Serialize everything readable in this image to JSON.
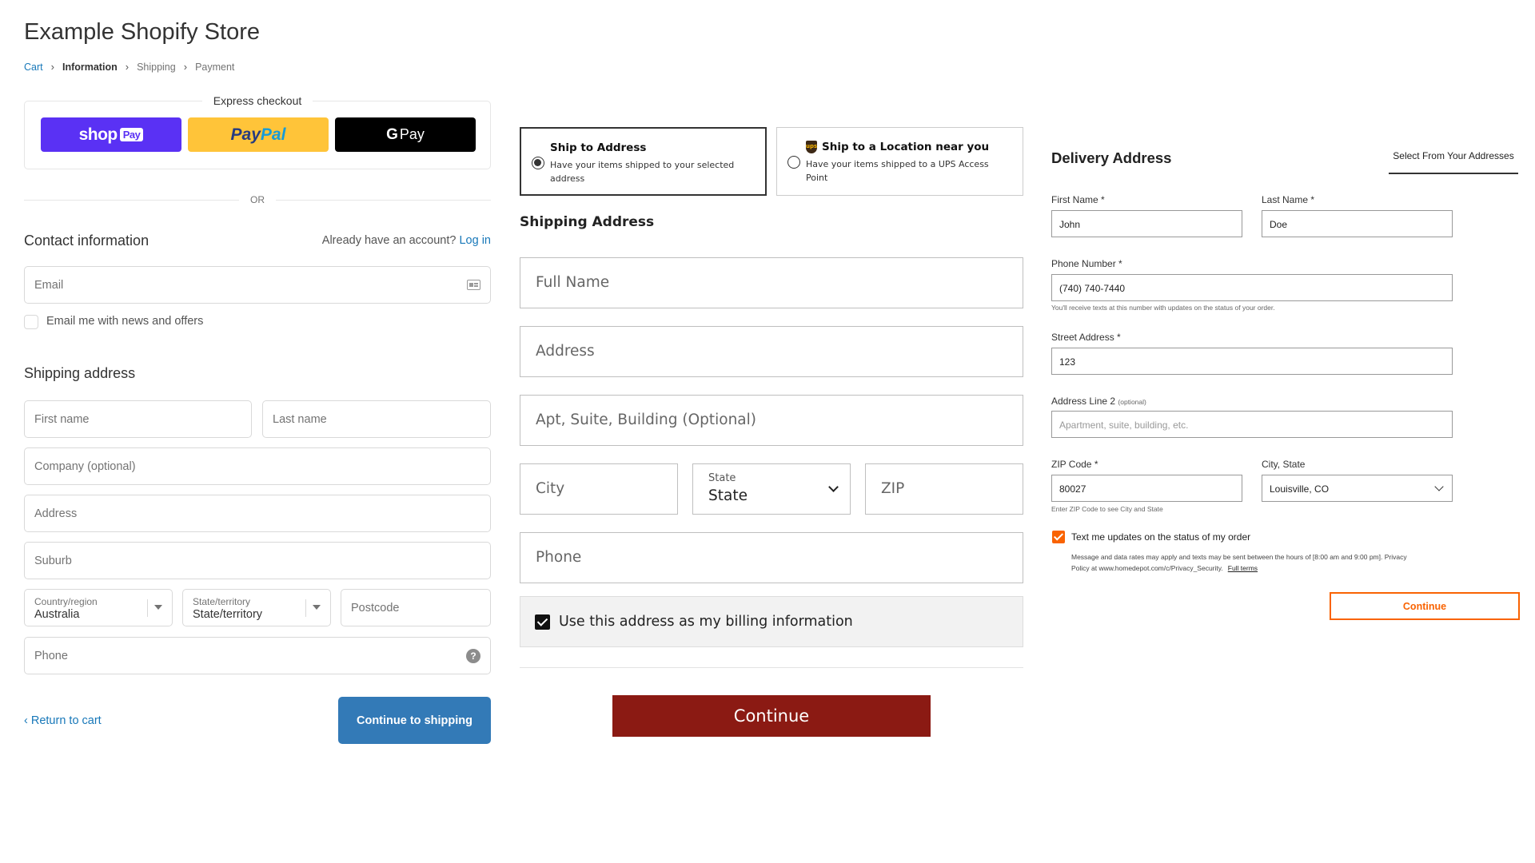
{
  "shopify": {
    "store_title": "Example Shopify Store",
    "breadcrumb": [
      "Cart",
      "Information",
      "Shipping",
      "Payment"
    ],
    "express": {
      "label": "Express checkout",
      "shop_pay": "shop",
      "shop_pay_badge": "Pay",
      "paypal_1": "Pay",
      "paypal_2": "Pal",
      "gpay_g": "G",
      "gpay_text": "Pay"
    },
    "or_label": "OR",
    "contact": {
      "heading": "Contact information",
      "account_prompt": "Already have an account?",
      "login": "Log in",
      "email_placeholder": "Email",
      "newsletter_label": "Email me with news and offers"
    },
    "shipping": {
      "heading": "Shipping address",
      "first_name": "First name",
      "last_name": "Last name",
      "company": "Company (optional)",
      "address": "Address",
      "suburb": "Suburb",
      "country_label": "Country/region",
      "country_value": "Australia",
      "state_label": "State/territory",
      "state_value": "State/territory",
      "postcode": "Postcode",
      "phone": "Phone"
    },
    "return_link": "Return to cart",
    "continue_button": "Continue to shipping"
  },
  "shipping_form": {
    "option_address": {
      "title": "Ship to Address",
      "desc": "Have your items shipped to your selected address",
      "selected": true
    },
    "option_location": {
      "title": "Ship to a Location near you",
      "desc": "Have your items shipped to a UPS Access Point",
      "icon": "ups-icon",
      "selected": false
    },
    "heading": "Shipping Address",
    "full_name": "Full Name",
    "address": "Address",
    "apt": "Apt, Suite, Building (Optional)",
    "city": "City",
    "state_label": "State",
    "state_value": "State",
    "zip": "ZIP",
    "phone": "Phone",
    "billing_label": "Use this address as my billing information",
    "billing_checked": true,
    "continue_button": "Continue",
    "accent_color": "#8b1a13"
  },
  "home_depot": {
    "heading": "Delivery Address",
    "select_addresses": "Select From Your Addresses",
    "first_name_label": "First Name",
    "first_name_value": "John",
    "last_name_label": "Last Name",
    "last_name_value": "Doe",
    "phone_label": "Phone Number",
    "phone_value": "(740) 740-7440",
    "phone_help": "You'll receive texts at this number with updates on the status of your order.",
    "street_label": "Street Address",
    "street_value": "123",
    "address2_label": "Address Line 2",
    "address2_optional": "(optional)",
    "address2_placeholder": "Apartment, suite, building, etc.",
    "zip_label": "ZIP Code",
    "zip_value": "80027",
    "zip_help": "Enter ZIP Code to see City and State",
    "city_state_label": "City, State",
    "city_state_value": "Louisville, CO",
    "text_updates_label": "Text me updates on the status of my order",
    "text_updates_checked": true,
    "fine_print": "Message and data rates may apply and texts may be sent between the hours of [8:00 am and 9:00 pm]. Privacy Policy at www.homedepot.com/c/Privacy_Security.",
    "full_terms": "Full terms",
    "continue_button": "Continue",
    "accent_color": "#f96302"
  }
}
